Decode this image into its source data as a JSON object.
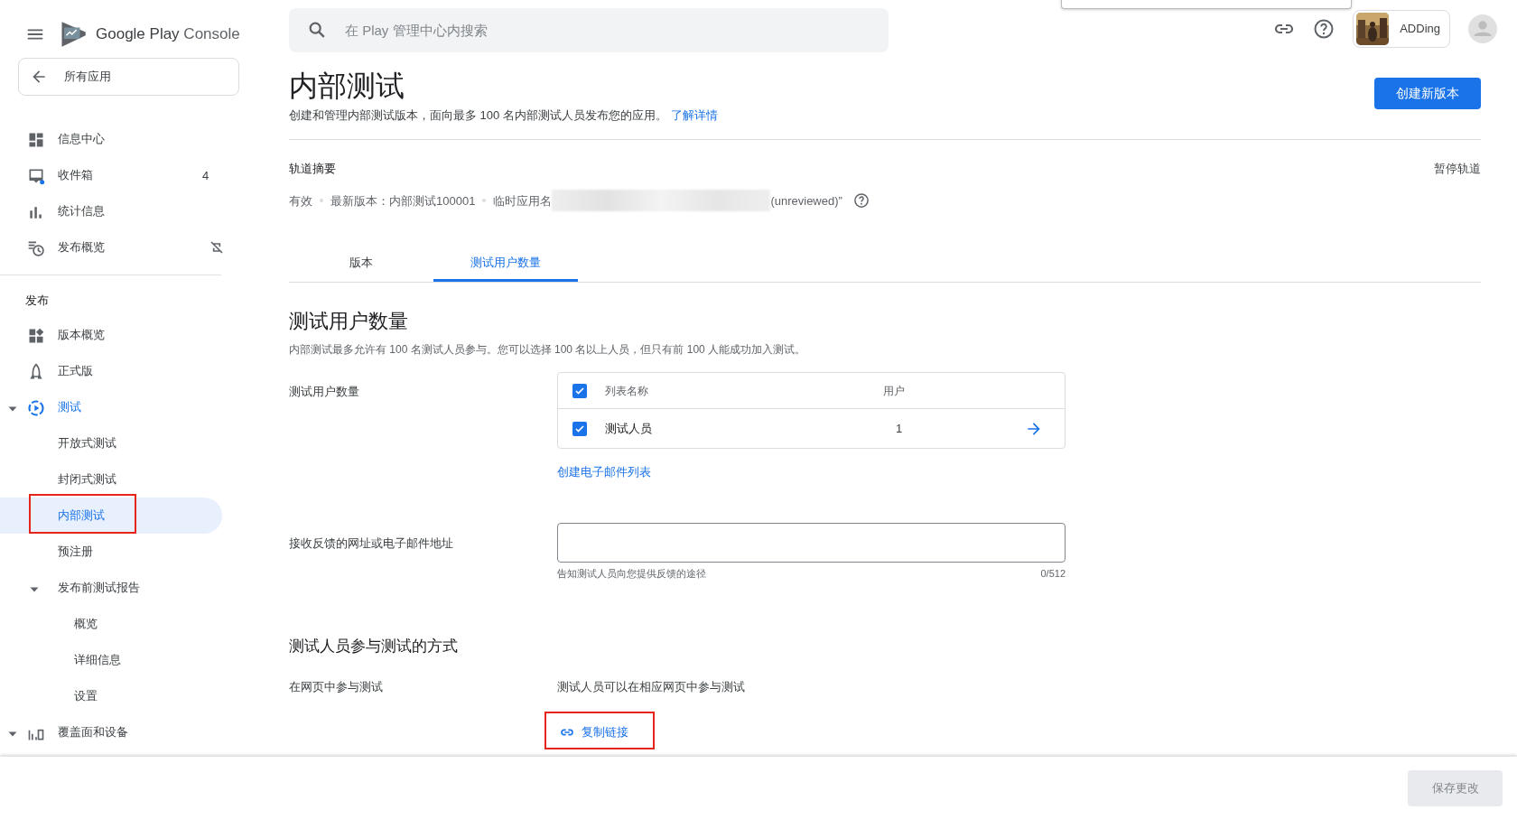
{
  "header": {
    "logo": {
      "brand": "Google Play",
      "product": "Console"
    },
    "search": {
      "placeholder": "在 Play 管理中心内搜索"
    },
    "app_chip": {
      "name": "ADDing",
      "kind": "picture"
    }
  },
  "sidebar": {
    "back": "所有应用",
    "items": [
      {
        "label": "信息中心",
        "kind": "dashboard",
        "selected": false
      },
      {
        "label": "收件箱",
        "kind": "inbox",
        "badge": "4",
        "selected": false
      },
      {
        "label": "统计信息",
        "kind": "stats",
        "selected": false
      },
      {
        "label": "发布概览",
        "kind": "overview",
        "sync_off": true,
        "selected": false
      }
    ],
    "section": "发布",
    "publish_items": [
      {
        "label": "版本概览",
        "kind": "releases",
        "selected": false
      },
      {
        "label": "正式版",
        "kind": "production",
        "selected": false
      },
      {
        "label": "测试",
        "kind": "testing",
        "expanded": true,
        "active": true,
        "selected": false,
        "children": [
          {
            "label": "开放式测试",
            "selected": false
          },
          {
            "label": "封闭式测试",
            "selected": false
          },
          {
            "label": "内部测试",
            "selected": true,
            "annotated": true
          },
          {
            "label": "预注册",
            "selected": false
          },
          {
            "label": "发布前测试报告",
            "expanded": true,
            "selected": false,
            "children": [
              {
                "label": "概览",
                "selected": false
              },
              {
                "label": "详细信息",
                "selected": false
              },
              {
                "label": "设置",
                "selected": false
              }
            ]
          }
        ]
      },
      {
        "label": "覆盖面和设备",
        "kind": "coverage",
        "expanded": true,
        "selected": false
      }
    ]
  },
  "page": {
    "title": "内部测试",
    "description": "创建和管理内部测试版本，面向最多 100 名内部测试人员发布您的应用。",
    "learn_more": "了解详情",
    "primary_button": "创建新版本"
  },
  "track_summary": {
    "heading": "轨道摘要",
    "pause": "暂停轨道",
    "status": "有效",
    "latest": "最新版本：内部测试100001",
    "app_name_prefix": "临时应用名",
    "app_name_suffix": "(unreviewed)”"
  },
  "tabs": [
    {
      "label": "版本",
      "selected": false
    },
    {
      "label": "测试用户数量",
      "selected": true
    }
  ],
  "testers": {
    "heading": "测试用户数量",
    "description": "内部测试最多允许有 100 名测试人员参与。您可以选择 100 名以上人员，但只有前 100 人能成功加入测试。",
    "label": "测试用户数量",
    "columns": [
      "列表名称",
      "用户"
    ],
    "header_checked": true,
    "rows": [
      {
        "name": "测试人员",
        "users": "1",
        "checked": true
      }
    ],
    "create_link": "创建电子邮件列表"
  },
  "feedback": {
    "label": "接收反馈的网址或电子邮件地址",
    "helper": "告知测试人员向您提供反馈的途径",
    "counter": "0/512"
  },
  "join": {
    "heading": "测试人员参与测试的方式",
    "label": "在网页中参与测试",
    "text": "测试人员可以在相应网页中参与测试",
    "copy_link": {
      "label": "复制链接",
      "annotated": true
    }
  },
  "footer": {
    "save": "保存更改",
    "disabled": true
  }
}
